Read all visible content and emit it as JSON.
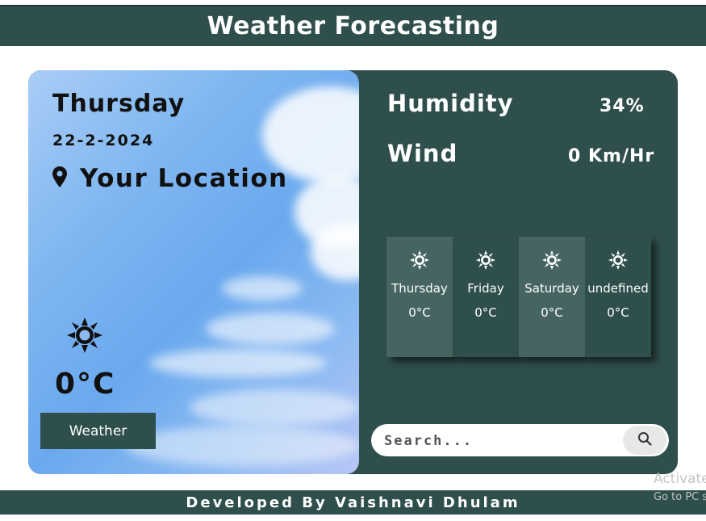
{
  "header": {
    "title": "Weather Forecasting"
  },
  "current": {
    "day": "Thursday",
    "date": "22-2-2024",
    "location": "Your Location",
    "temperature": "0°C",
    "icon": "sun-icon",
    "button_label": "Weather"
  },
  "stats": {
    "humidity_label": "Humidity",
    "humidity_value": "34%",
    "wind_label": "Wind",
    "wind_value": "0 Km/Hr"
  },
  "forecast": [
    {
      "day": "Thursday",
      "temp": "0°C",
      "icon": "sun-icon"
    },
    {
      "day": "Friday",
      "temp": "0°C",
      "icon": "sun-icon"
    },
    {
      "day": "Saturday",
      "temp": "0°C",
      "icon": "sun-icon"
    },
    {
      "day": "undefined",
      "temp": "0°C",
      "icon": "sun-icon"
    }
  ],
  "search": {
    "placeholder": "Search..."
  },
  "footer": {
    "text": "Developed By Vaishnavi Dhulam"
  },
  "watermark": {
    "line1": "Activate",
    "line2": "Go to PC s"
  },
  "colors": {
    "primary": "#2f4f4c",
    "card_light": "#466562",
    "sky": "#7fb6f1",
    "white": "#ffffff"
  }
}
